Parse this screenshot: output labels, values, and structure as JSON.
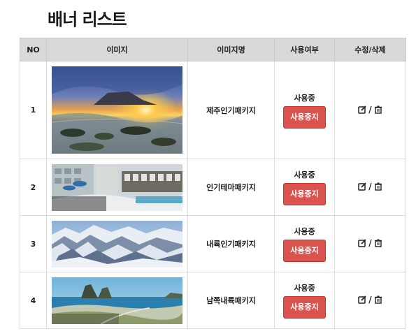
{
  "page": {
    "title": "배너 리스트"
  },
  "table": {
    "headers": {
      "no": "NO",
      "image": "이미지",
      "name": "이미지명",
      "use": "사용여부",
      "edit": "수정/삭제"
    },
    "rows": [
      {
        "no": "1",
        "image_icon": "jeju-sunrise-photo",
        "name": "제주인기패키지",
        "status": "사용중",
        "stop_label": "사용중지"
      },
      {
        "no": "2",
        "image_icon": "resort-pool-photo",
        "name": "인기테마패키지",
        "status": "사용중",
        "stop_label": "사용중지"
      },
      {
        "no": "3",
        "image_icon": "snowy-mountains-photo",
        "name": "내륙인기패키지",
        "status": "사용중",
        "stop_label": "사용중지"
      },
      {
        "no": "4",
        "image_icon": "coastal-rocks-photo",
        "name": "남쪽내륙패키지",
        "status": "사용중",
        "stop_label": "사용중지"
      }
    ],
    "edit_separator": "/",
    "icons": {
      "edit": "edit-icon",
      "delete": "trash-icon"
    }
  },
  "colors": {
    "header_bg": "#d9d9d9",
    "stop_button": "#d9534f"
  }
}
